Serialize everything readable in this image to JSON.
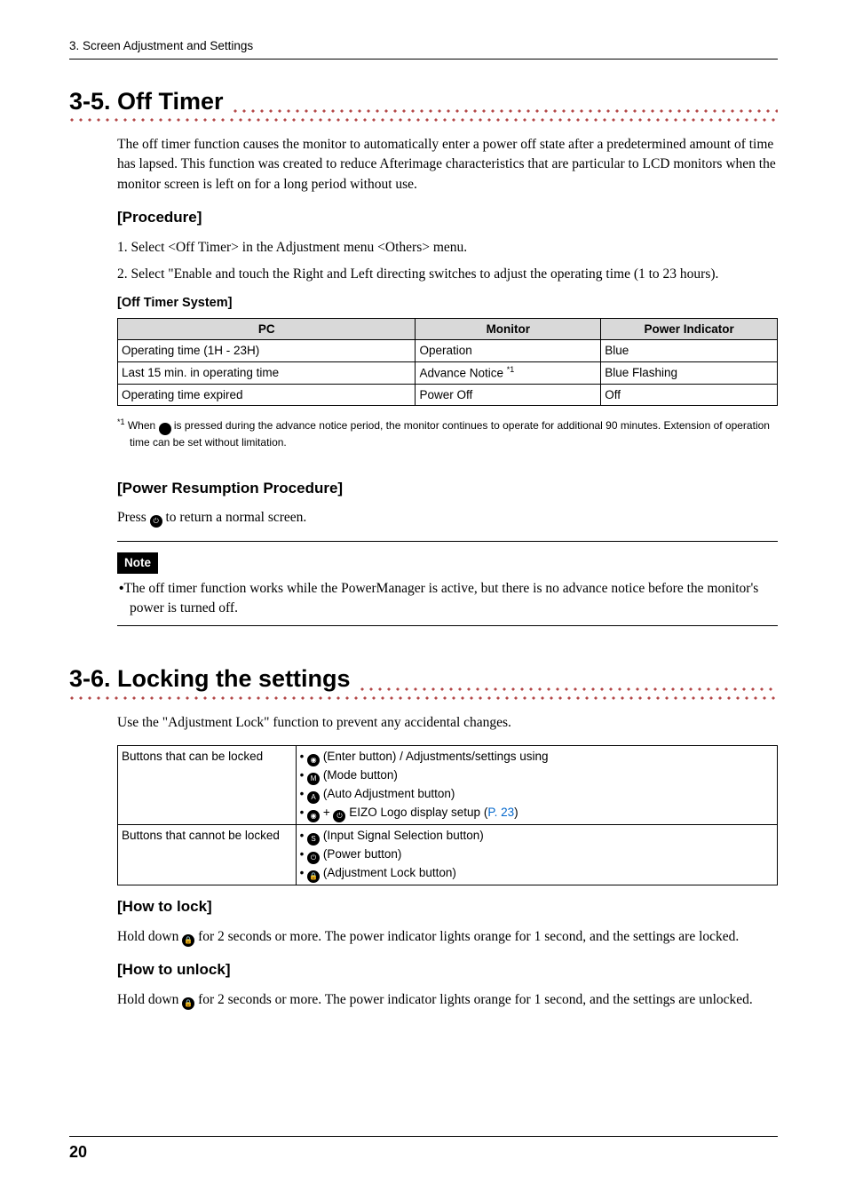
{
  "breadcrumb": "3. Screen Adjustment and Settings",
  "section35": {
    "heading": "3-5. Off Timer",
    "intro": "The off timer function causes the monitor to automatically enter a power off state after a predetermined amount of time has lapsed. This function was created to reduce Afterimage characteristics that are particular to LCD monitors when the monitor screen is left on for a long period without use.",
    "procedure_heading": "[Procedure]",
    "steps": [
      "1. Select <Off Timer> in the Adjustment menu <Others> menu.",
      "2. Select \"Enable and touch the Right and Left directing switches to adjust the operating time (1 to 23 hours)."
    ],
    "system_heading": "[Off Timer System]",
    "table_headers": [
      "PC",
      "Monitor",
      "Power Indicator"
    ],
    "table_rows": [
      {
        "pc": "Operating time (1H - 23H)",
        "monitor": "Operation",
        "pi": "Blue"
      },
      {
        "pc": "Last 15 min. in operating time",
        "monitor_pre": "Advance Notice ",
        "monitor_sup": "*1",
        "pi": "Blue Flashing"
      },
      {
        "pc": "Operating time expired",
        "monitor": "Power Off",
        "pi": "Off"
      }
    ],
    "footnote_sup": "*1",
    "footnote_pre": " When ",
    "footnote_post": " is pressed during the advance notice period, the monitor continues to operate for additional 90 minutes. Extension of operation time can be set without limitation.",
    "resume_heading": "[Power Resumption Procedure]",
    "resume_pre": "Press ",
    "resume_post": " to return a normal screen.",
    "note_label": "Note",
    "note_bullet": "The off timer function works while the PowerManager is active, but there is no advance notice before the monitor's power is turned off."
  },
  "section36": {
    "heading": "3-6. Locking the settings",
    "intro": "Use the \"Adjustment Lock\" function to prevent any accidental changes.",
    "row1_label": "Buttons that can be locked",
    "row1_items": {
      "enter": " (Enter button) / Adjustments/settings using",
      "mode": " (Mode button)",
      "auto": " (Auto Adjustment button)",
      "logo_mid": " + ",
      "logo_post": " EIZO Logo display setup (",
      "logo_link": "P. 23",
      "logo_close": ")"
    },
    "row2_label": "Buttons that cannot be locked",
    "row2_items": {
      "signal": " (Input Signal Selection button)",
      "power": " (Power button)",
      "lock": " (Adjustment Lock button)"
    },
    "lock_heading": "[How to lock]",
    "lock_pre": "Hold down ",
    "lock_post": " for 2 seconds or more. The power indicator lights orange for 1 second, and the settings are locked.",
    "unlock_heading": "[How to unlock]",
    "unlock_pre": "Hold down ",
    "unlock_post": " for 2 seconds or more. The power indicator lights orange for 1 second, and the settings are unlocked."
  },
  "page_number": "20"
}
